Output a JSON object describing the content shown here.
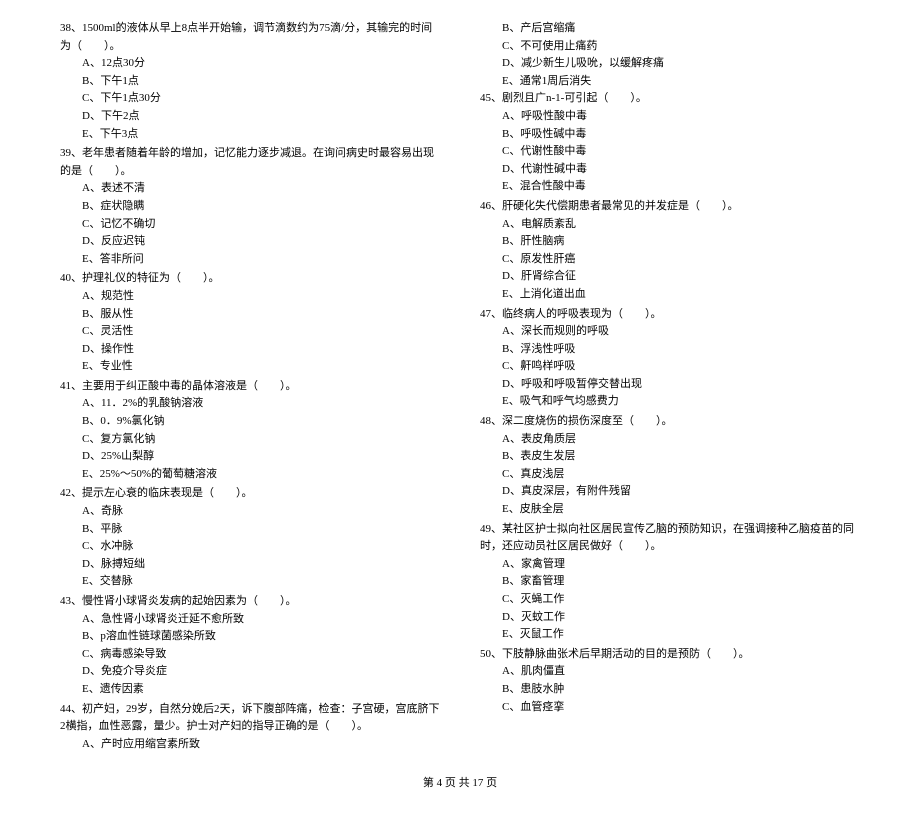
{
  "left_column": [
    {
      "num": "38、",
      "text": "1500ml的液体从早上8点半开始输，调节滴数约为75滴/分，其输完的时间为（　　）。",
      "options": [
        "A、12点30分",
        "B、下午1点",
        "C、下午1点30分",
        "D、下午2点",
        "E、下午3点"
      ]
    },
    {
      "num": "39、",
      "text": "老年患者随着年龄的增加，记忆能力逐步减退。在询问病史时最容易出现的是（　　）。",
      "options": [
        "A、表述不清",
        "B、症状隐瞒",
        "C、记忆不确切",
        "D、反应迟钝",
        "E、答非所问"
      ]
    },
    {
      "num": "40、",
      "text": "护理礼仪的特征为（　　）。",
      "options": [
        "A、规范性",
        "B、服从性",
        "C、灵活性",
        "D、操作性",
        "E、专业性"
      ]
    },
    {
      "num": "41、",
      "text": "主要用于纠正酸中毒的晶体溶液是（　　）。",
      "options": [
        "A、11．2%的乳酸钠溶液",
        "B、0．9%氯化钠",
        "C、复方氯化钠",
        "D、25%山梨醇",
        "E、25%～50%的葡萄糖溶液"
      ]
    },
    {
      "num": "42、",
      "text": "提示左心衰的临床表现是（　　）。",
      "options": [
        "A、奇脉",
        "B、平脉",
        "C、水冲脉",
        "D、脉搏短绌",
        "E、交替脉"
      ]
    },
    {
      "num": "43、",
      "text": "慢性肾小球肾炎发病的起始因素为（　　）。",
      "options": [
        "A、急性肾小球肾炎迁延不愈所致",
        "B、p溶血性链球菌感染所致",
        "C、病毒感染导致",
        "D、免疫介导炎症",
        "E、遗传因素"
      ]
    },
    {
      "num": "44、",
      "text": "初产妇，29岁，自然分娩后2天，诉下腹部阵痛，检查：子宫硬，宫底脐下2横指，血性恶露，量少。护士对产妇的指导正确的是（　　）。",
      "options": [
        "A、产时应用缩宫素所致"
      ]
    }
  ],
  "right_column_orphan_options": [
    "B、产后宫缩痛",
    "C、不可使用止痛药",
    "D、减少新生儿吸吮，以缓解疼痛",
    "E、通常1周后消失"
  ],
  "right_column": [
    {
      "num": "45、",
      "text": "剧烈且广n-1-可引起（　　）。",
      "options": [
        "A、呼吸性酸中毒",
        "B、呼吸性碱中毒",
        "C、代谢性酸中毒",
        "D、代谢性碱中毒",
        "E、混合性酸中毒"
      ]
    },
    {
      "num": "46、",
      "text": "肝硬化失代偿期患者最常见的并发症是（　　）。",
      "options": [
        "A、电解质紊乱",
        "B、肝性脑病",
        "C、原发性肝癌",
        "D、肝肾综合征",
        "E、上消化道出血"
      ]
    },
    {
      "num": "47、",
      "text": "临终病人的呼吸表现为（　　）。",
      "options": [
        "A、深长而规则的呼吸",
        "B、浮浅性呼吸",
        "C、鼾鸣样呼吸",
        "D、呼吸和呼吸暂停交替出现",
        "E、吸气和呼气均感费力"
      ]
    },
    {
      "num": "48、",
      "text": "深二度烧伤的损伤深度至（　　）。",
      "options": [
        "A、表皮角质层",
        "B、表皮生发层",
        "C、真皮浅层",
        "D、真皮深层，有附件残留",
        "E、皮肤全层"
      ]
    },
    {
      "num": "49、",
      "text": "某社区护士拟向社区居民宣传乙脑的预防知识，在强调接种乙脑疫苗的同时，还应动员社区居民做好（　　）。",
      "options": [
        "A、家禽管理",
        "B、家畜管理",
        "C、灭蝇工作",
        "D、灭蚊工作",
        "E、灭鼠工作"
      ]
    },
    {
      "num": "50、",
      "text": "下肢静脉曲张术后早期活动的目的是预防（　　）。",
      "options": [
        "A、肌肉僵直",
        "B、患肢水肿",
        "C、血管痉挛"
      ]
    }
  ],
  "footer": "第 4 页 共 17 页"
}
